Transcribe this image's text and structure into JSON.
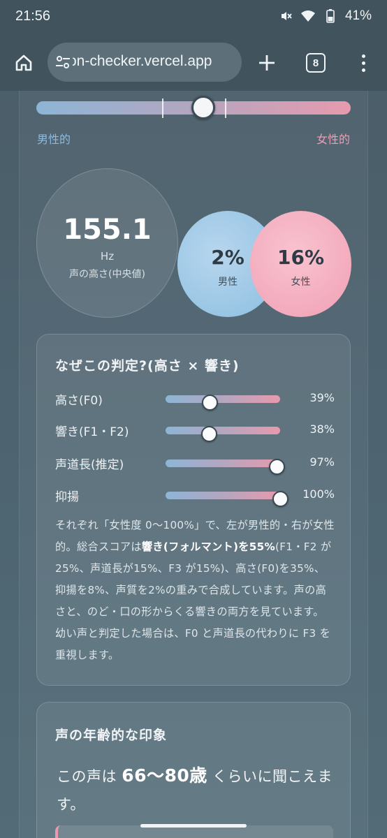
{
  "status_bar": {
    "time": "21:56",
    "battery": "41%",
    "icons": [
      "mute-icon",
      "wifi-icon",
      "battery-icon"
    ]
  },
  "browser": {
    "url": "on-checker.vercel.app",
    "tab_count": "8",
    "icons": [
      "home-icon",
      "site-settings-icon",
      "plus-icon",
      "tab-switcher-icon",
      "more-menu-icon"
    ]
  },
  "gender_slider": {
    "male_label": "男性的",
    "female_label": "女性的",
    "position": 0.53
  },
  "pitch": {
    "value": "155.1",
    "unit": "Hz",
    "caption": "声の高さ(中央値)"
  },
  "male": {
    "percent": "2%",
    "label": "男性"
  },
  "female": {
    "percent": "16%",
    "label": "女性"
  },
  "why": {
    "title": "なぜこの判定?(高さ × 響き)",
    "rows": [
      {
        "label": "高さ(F0)",
        "percent": "39%",
        "value": 0.39
      },
      {
        "label": "響き(F1・F2)",
        "percent": "38%",
        "value": 0.38
      },
      {
        "label": "声道長(推定)",
        "percent": "97%",
        "value": 0.97
      },
      {
        "label": "抑揚",
        "percent": "100%",
        "value": 1.0
      }
    ],
    "body_part1": "それぞれ「女性度 0〜100%」で、左が男性的・右が女性的。総合スコアは",
    "body_bold": "響き(フォルマント)を55%",
    "body_part2": "(F1・F2 が25%、声道長が15%、F3 が15%)、高さ(F0)を35%、抑揚を8%、声質を2%の重みで合成しています。声の高さと、のど・口の形からくる響きの両方を見ています。幼い声と判定した場合は、F0 と声道長の代わりに F3 を重視します。"
  },
  "age": {
    "title": "声の年齢的な印象",
    "prefix": "この声は ",
    "range": "66〜80歳",
    "suffix": " くらいに聞こえます。"
  },
  "colors": {
    "male": "#8bbfe0",
    "female": "#f0a0b4",
    "background": "#4d6470"
  }
}
